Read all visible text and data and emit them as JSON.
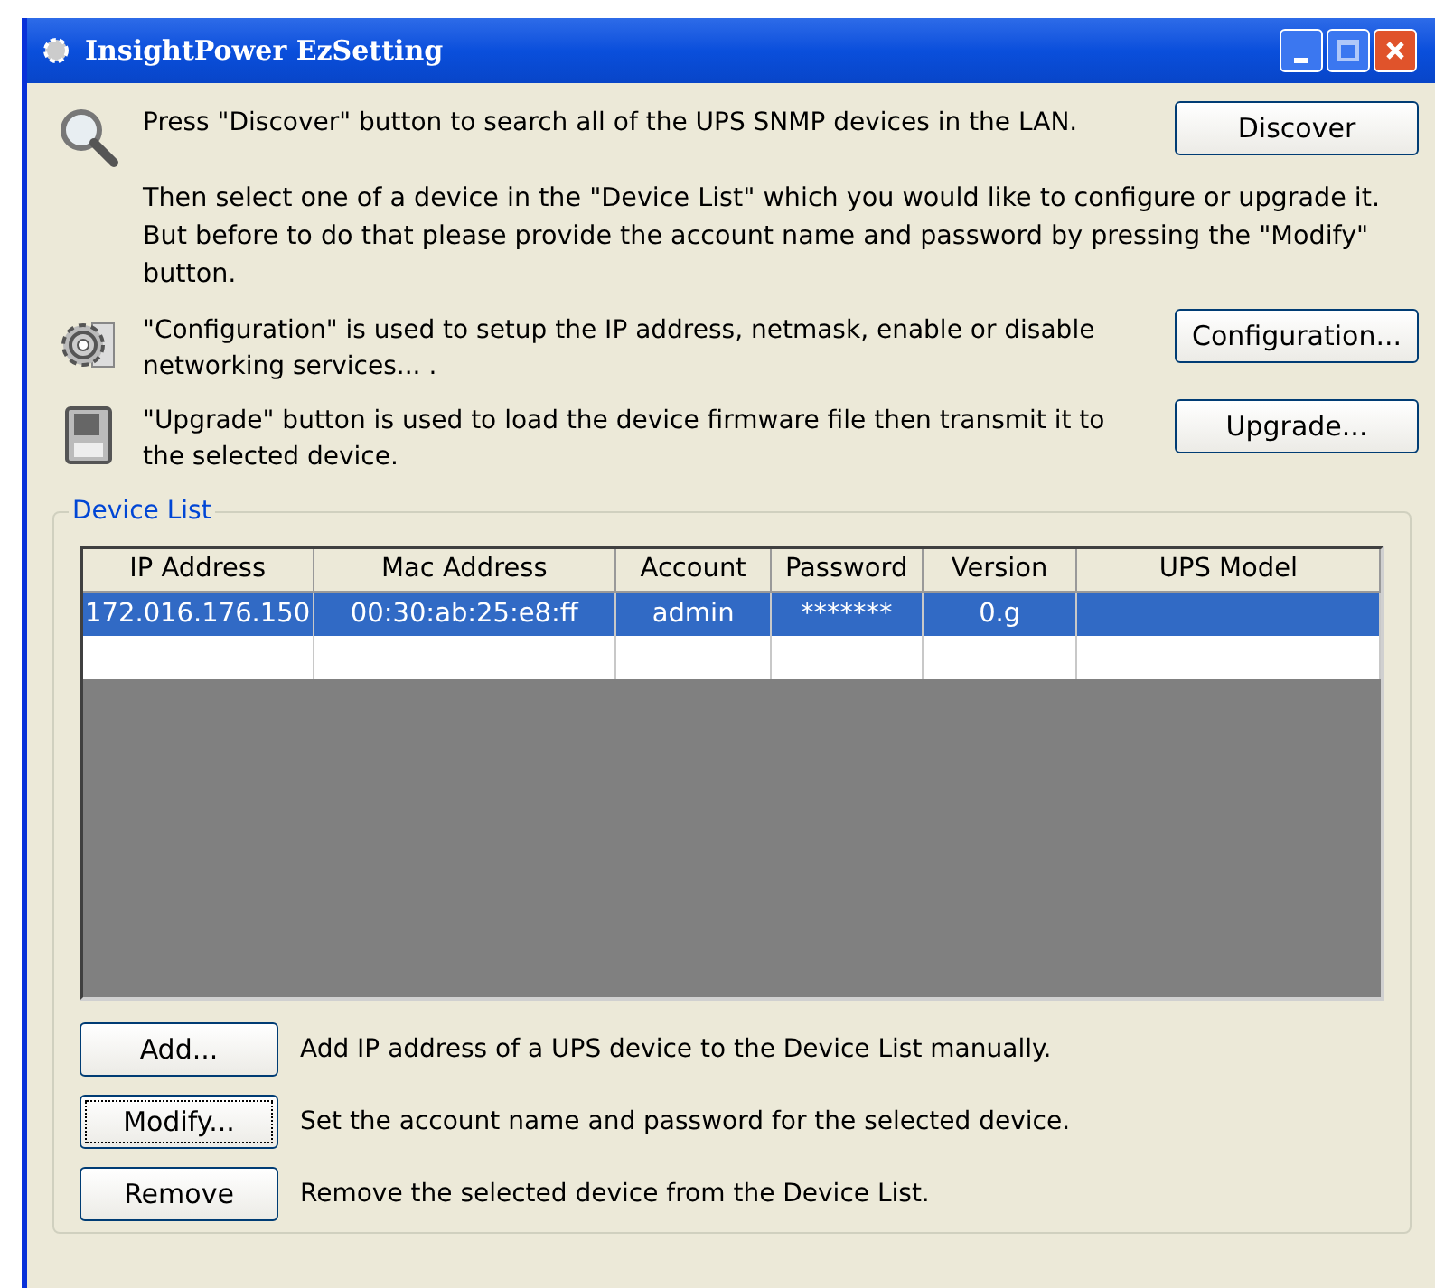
{
  "window": {
    "title": "InsightPower EzSetting"
  },
  "intro": [
    {
      "kind": "search",
      "text": "Press \"Discover\" button to search all of the UPS SNMP devices in the LAN.",
      "button": "Discover",
      "note": "Then select one of a device in the \"Device List\" which you would like to configure or upgrade it. But before to do that please provide the account name and password by pressing the \"Modify\" button."
    },
    {
      "kind": "gear",
      "text": "\"Configuration\" is used to setup the IP address, netmask, enable or disable networking services... .",
      "button": "Configuration..."
    },
    {
      "kind": "disk",
      "text": "\"Upgrade\" button is used to load the device firmware file then transmit it to the selected device.",
      "button": "Upgrade..."
    }
  ],
  "device_list": {
    "title": "Device List",
    "columns": [
      "IP Address",
      "Mac Address",
      "Account",
      "Password",
      "Version",
      "UPS Model"
    ],
    "rows": [
      {
        "selected": true,
        "cells": [
          "172.016.176.150",
          "00:30:ab:25:e8:ff",
          "admin",
          "*******",
          "0.g",
          ""
        ]
      }
    ]
  },
  "actions": [
    {
      "button": "Add...",
      "text": "Add IP address of a UPS device to the Device List manually.",
      "focused": false
    },
    {
      "button": "Modify...",
      "text": "Set the account name and password for the selected device.",
      "focused": true
    },
    {
      "button": "Remove",
      "text": "Remove the selected device from the Device List.",
      "focused": false
    }
  ]
}
